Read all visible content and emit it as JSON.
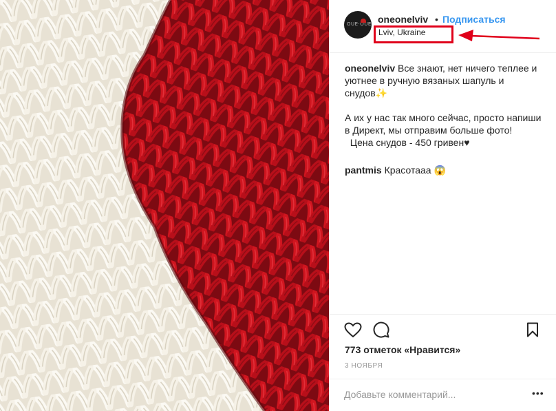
{
  "post": {
    "username": "oneonelviv",
    "separator": "•",
    "follow_label": "Подписаться",
    "location": "Lviv, Ukraine",
    "caption_user": "oneonelviv",
    "caption_text": " Все знают, нет ничего теплее и уютнее в ручную вязаных шапуль и снудов✨\n\nА их у нас так много сейчас, просто напиши в Директ, мы отправим больше фото!\n  Цена снудов - 450 гривен♥",
    "comments": [
      {
        "user": "pantmis",
        "text": " Красотааа 😱"
      }
    ],
    "likes_text": "773 отметок «Нравится»",
    "date": "3 НОЯБРЯ",
    "comment_placeholder": "Добавьте комментарий...",
    "more_label": "•••"
  },
  "icons": {
    "like": "heart-icon",
    "comment": "comment-bubble-icon",
    "save": "bookmark-icon",
    "annotation": "red-arrow-icon"
  },
  "colors": {
    "accent": "#3897f0",
    "annotation": "#e0001a",
    "knit_white": "#ede8dc",
    "knit_red": "#c0121c"
  }
}
